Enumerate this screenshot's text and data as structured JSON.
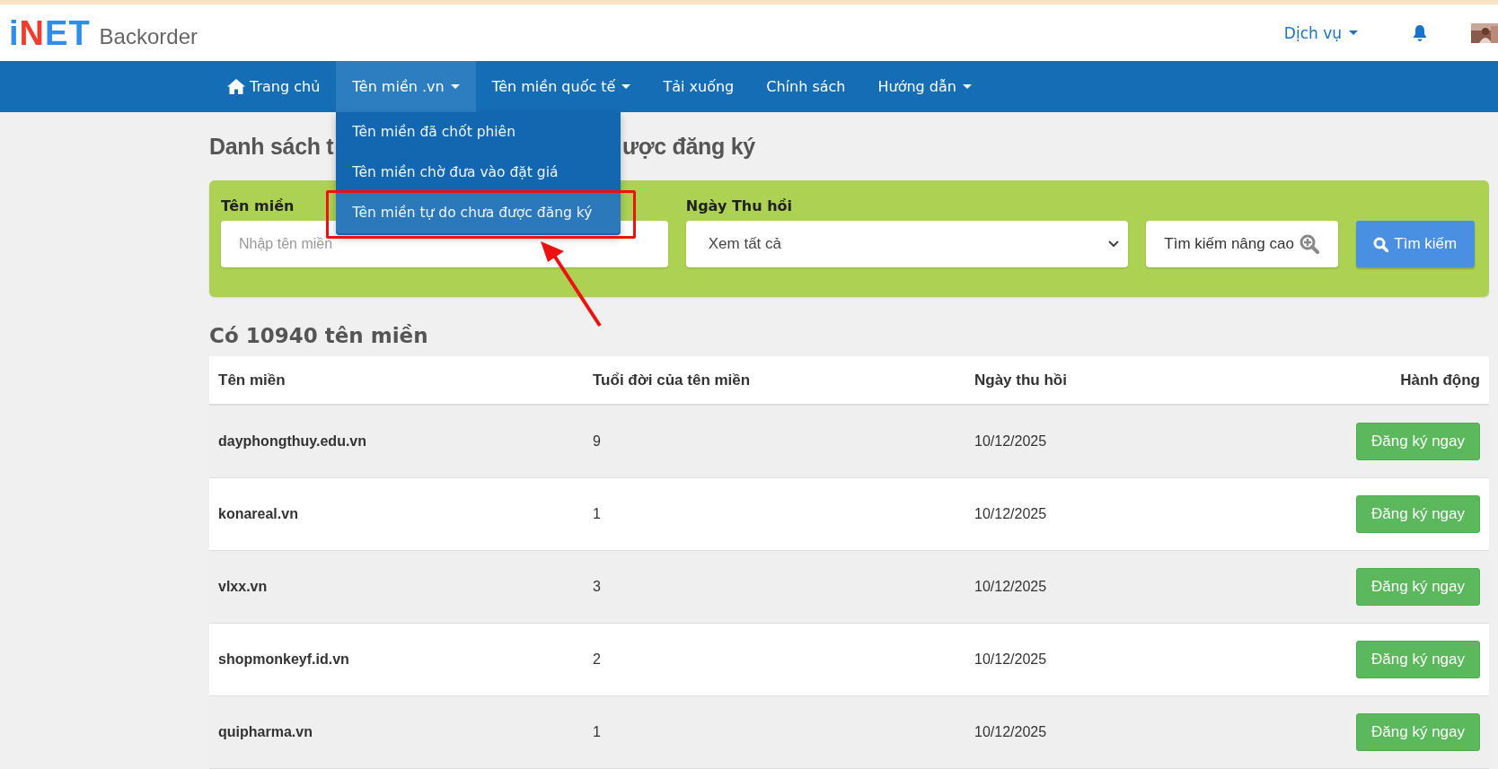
{
  "header": {
    "logo": "iNET",
    "product": "Backorder",
    "services_menu": "Dịch vụ"
  },
  "nav": [
    {
      "label": "Trang chủ",
      "kind": "home",
      "selected": false
    },
    {
      "label": "Tên miền .vn",
      "kind": "menu",
      "selected": true
    },
    {
      "label": "Tên miền quốc tế",
      "kind": "menu",
      "selected": false
    },
    {
      "label": "Tải xuống",
      "kind": "link",
      "selected": false
    },
    {
      "label": "Chính sách",
      "kind": "link",
      "selected": false
    },
    {
      "label": "Hướng dẫn",
      "kind": "menu",
      "selected": false
    }
  ],
  "dropdown": [
    {
      "label": "Tên miền đã chốt phiên",
      "selected": false
    },
    {
      "label": "Tên miền chờ đưa vào đặt giá",
      "selected": false
    },
    {
      "label": "Tên miền tự do chưa được đăng ký",
      "selected": true
    }
  ],
  "page_title_visible": [
    "Danh sách t",
    "ược đăng ký"
  ],
  "search_form": {
    "domain_label": "Tên miền",
    "domain_placeholder": "Nhập tên miền",
    "date_label": "Ngày Thu hồi",
    "date_value": "Xem tất cả",
    "advanced_button": "Tìm kiếm nâng cao",
    "search_button": "Tìm kiếm"
  },
  "result_count": "Có 10940 tên miền",
  "table": {
    "columns": [
      "Tên miền",
      "Tuổi đời của tên miền",
      "Ngày thu hồi",
      "Hành động"
    ],
    "rows": [
      {
        "domain": "dayphongthuy.edu.vn",
        "age": "9",
        "date": "10/12/2025",
        "action": "Đăng ký ngay"
      },
      {
        "domain": "konareal.vn",
        "age": "1",
        "date": "10/12/2025",
        "action": "Đăng ký ngay"
      },
      {
        "domain": "vlxx.vn",
        "age": "3",
        "date": "10/12/2025",
        "action": "Đăng ký ngay"
      },
      {
        "domain": "shopmonkeyf.id.vn",
        "age": "2",
        "date": "10/12/2025",
        "action": "Đăng ký ngay"
      },
      {
        "domain": "quipharma.vn",
        "age": "1",
        "date": "10/12/2025",
        "action": "Đăng ký ngay"
      }
    ]
  }
}
